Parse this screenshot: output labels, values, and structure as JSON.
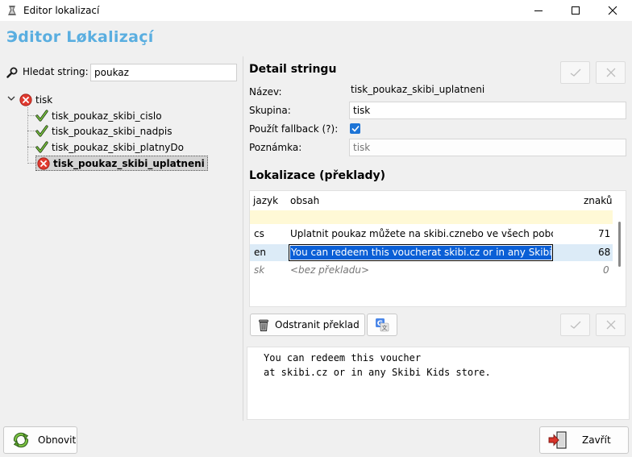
{
  "window": {
    "title": "Editor lokalizací",
    "header": "Эditor Løkalizaçí"
  },
  "search": {
    "label": "Hledat string:",
    "value": "poukaz"
  },
  "tree": {
    "root": {
      "label": "tisk",
      "status": "error"
    },
    "children": [
      {
        "label": "tisk_poukaz_skibi_cislo",
        "status": "ok"
      },
      {
        "label": "tisk_poukaz_skibi_nadpis",
        "status": "ok"
      },
      {
        "label": "tisk_poukaz_skibi_platnyDo",
        "status": "ok"
      },
      {
        "label": "tisk_poukaz_skibi_uplatneni",
        "status": "error",
        "selected": true
      }
    ]
  },
  "detail": {
    "section_title": "Detail stringu",
    "name_label": "Název:",
    "name_value": "tisk_poukaz_skibi_uplatneni",
    "group_label": "Skupina:",
    "group_value": "tisk",
    "fallback_label": "Použít fallback (?):",
    "fallback_checked": true,
    "note_label": "Poznámka:",
    "note_placeholder": "tisk"
  },
  "localizations": {
    "section_title": "Lokalizace (překlady)",
    "columns": {
      "lang": "jazyk",
      "content": "obsah",
      "chars": "znaků"
    },
    "rows": [
      {
        "lang": "cs",
        "content": "Uplatnit poukaz můžete na skibi.cznebo ve všech poboč",
        "chars": "71"
      },
      {
        "lang": "en",
        "content": "You can redeem this voucherat skibi.cz or in any Skibi K",
        "chars": "68",
        "editing": true
      },
      {
        "lang": "sk",
        "content": "<bez překladu>",
        "chars": "0",
        "missing": true
      }
    ],
    "remove_button": "Odstranit překlad",
    "translate_icon": "google-translate-icon"
  },
  "editor": {
    "text": "You can redeem this voucher\nat skibi.cz or in any Skibi Kids store."
  },
  "footer": {
    "refresh_button": "Obnovit",
    "close_button": "Zavřít"
  },
  "colors": {
    "header": "#5aaee0",
    "selection": "#0a5fd6",
    "checkbox": "#1d74d6",
    "error": "#e03a2f",
    "ok_check": "#4a9a2a"
  }
}
